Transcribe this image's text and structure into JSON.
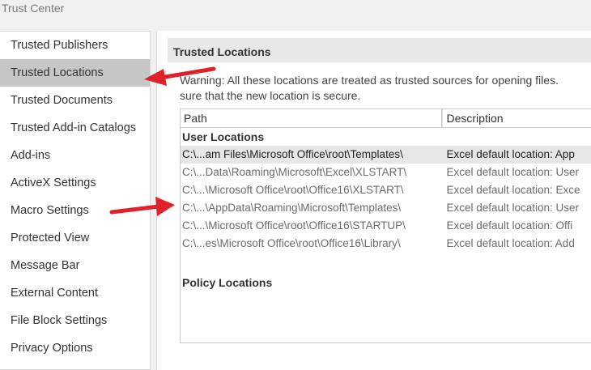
{
  "window": {
    "title": "Trust Center"
  },
  "sidebar": {
    "items": [
      {
        "label": "Trusted Publishers"
      },
      {
        "label": "Trusted Locations"
      },
      {
        "label": "Trusted Documents"
      },
      {
        "label": "Trusted Add-in Catalogs"
      },
      {
        "label": "Add-ins"
      },
      {
        "label": "ActiveX Settings"
      },
      {
        "label": "Macro Settings"
      },
      {
        "label": "Protected View"
      },
      {
        "label": "Message Bar"
      },
      {
        "label": "External Content"
      },
      {
        "label": "File Block Settings"
      },
      {
        "label": "Privacy Options"
      }
    ],
    "selected": "Trusted Locations"
  },
  "main": {
    "header": "Trusted Locations",
    "warning_line1": "Warning: All these locations are treated as trusted sources for opening files.",
    "warning_line2": "sure that the new location is secure.",
    "table": {
      "columns": {
        "path": "Path",
        "description": "Description"
      },
      "user_locations_label": "User Locations",
      "rows": [
        {
          "path": "C:\\...am Files\\Microsoft Office\\root\\Templates\\",
          "description": "Excel default location: App"
        },
        {
          "path": "C:\\...Data\\Roaming\\Microsoft\\Excel\\XLSTART\\",
          "description": "Excel default location: User"
        },
        {
          "path": "C:\\...\\Microsoft Office\\root\\Office16\\XLSTART\\",
          "description": "Excel default location: Exce"
        },
        {
          "path": "C:\\...\\AppData\\Roaming\\Microsoft\\Templates\\",
          "description": "Excel default location: User"
        },
        {
          "path": "C:\\...\\Microsoft Office\\root\\Office16\\STARTUP\\",
          "description": "Excel default location: Offi"
        },
        {
          "path": "C:\\...es\\Microsoft Office\\root\\Office16\\Library\\",
          "description": "Excel default location: Add"
        }
      ],
      "policy_locations_label": "Policy Locations"
    }
  },
  "colors": {
    "annotation_arrow": "#e0202a",
    "selected_sidebar": "#c6c6c6",
    "selected_row": "#e6e6e6"
  }
}
